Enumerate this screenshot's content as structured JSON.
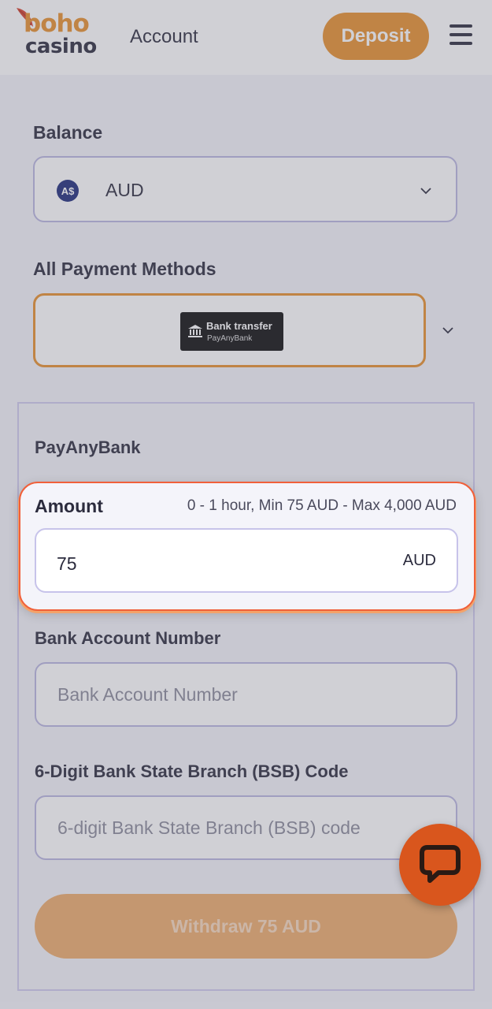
{
  "header": {
    "logo_top": "boho",
    "logo_bottom": "casino",
    "title": "Account",
    "deposit_label": "Deposit",
    "menu_icon": "hamburger-menu-icon"
  },
  "balance": {
    "label": "Balance",
    "currency_symbol": "A$",
    "currency": "AUD"
  },
  "payment_methods": {
    "label": "All Payment Methods",
    "selected_title": "Bank transfer",
    "selected_subtitle": "PayAnyBank"
  },
  "form": {
    "method_title": "PayAnyBank",
    "amount_label": "Amount",
    "amount_limits": "0 - 1 hour, Min 75 AUD - Max 4,000 AUD",
    "amount_value": "75",
    "amount_currency": "AUD",
    "account_label": "Bank Account Number",
    "account_placeholder": "Bank Account Number",
    "bsb_label": "6-Digit Bank State Branch (BSB) Code",
    "bsb_placeholder": "6-digit Bank State Branch (BSB) code",
    "submit_label": "Withdraw 75 AUD"
  },
  "colors": {
    "accent": "#e8902c",
    "chat": "#d9561d",
    "highlight_border": "#f0603a"
  }
}
